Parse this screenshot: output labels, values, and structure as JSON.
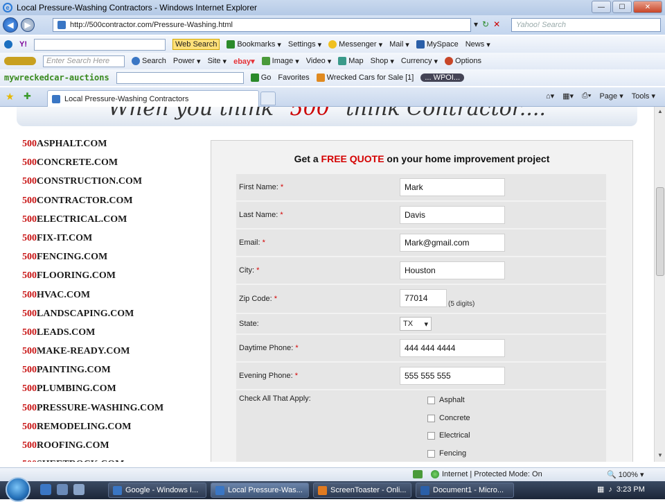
{
  "window": {
    "title": "Local Pressure-Washing Contractors - Windows Internet Explorer"
  },
  "address": {
    "url": "http://500contractor.com/Pressure-Washing.html",
    "search_placeholder": "Yahoo! Search"
  },
  "toolbar1": {
    "web_search": "Web Search",
    "bookmarks": "Bookmarks",
    "settings": "Settings",
    "messenger": "Messenger",
    "mail": "Mail",
    "myspace": "MySpace",
    "news": "News"
  },
  "toolbar2": {
    "search_placeholder": "Enter Search Here",
    "search": "Search",
    "power": "Power",
    "site": "Site",
    "image": "Image",
    "video": "Video",
    "map": "Map",
    "shop": "Shop",
    "currency": "Currency",
    "options": "Options"
  },
  "toolbar3": {
    "brand": "mywreckedcar-auctions",
    "go": "Go",
    "favorites": "Favorites",
    "wrecked": "Wrecked Cars for Sale",
    "wrecked_count": "[1]",
    "wpoi": "... WPOI..."
  },
  "tab": {
    "label": "Local Pressure-Washing Contractors"
  },
  "command": {
    "page": "Page",
    "tools": "Tools"
  },
  "banner": {
    "pre": "When you think ",
    "num": "\"500\"",
    "post": " think Contractor...."
  },
  "sites": [
    {
      "num": "500",
      "dom": "ASPHALT.COM"
    },
    {
      "num": "500",
      "dom": "CONCRETE.COM"
    },
    {
      "num": "500",
      "dom": "CONSTRUCTION.COM"
    },
    {
      "num": "500",
      "dom": "CONTRACTOR.COM"
    },
    {
      "num": "500",
      "dom": "ELECTRICAL.COM"
    },
    {
      "num": "500",
      "dom": "FIX-IT.COM"
    },
    {
      "num": "500",
      "dom": "FENCING.COM"
    },
    {
      "num": "500",
      "dom": "FLOORING.COM"
    },
    {
      "num": "500",
      "dom": "HVAC.COM"
    },
    {
      "num": "500",
      "dom": "LANDSCAPING.COM"
    },
    {
      "num": "500",
      "dom": "LEADS.COM"
    },
    {
      "num": "500",
      "dom": "MAKE-READY.COM"
    },
    {
      "num": "500",
      "dom": "PAINTING.COM"
    },
    {
      "num": "500",
      "dom": "PLUMBING.COM"
    },
    {
      "num": "500",
      "dom": "PRESSURE-WASHING.COM"
    },
    {
      "num": "500",
      "dom": "REMODELING.COM"
    },
    {
      "num": "500",
      "dom": "ROOFING.COM"
    },
    {
      "num": "500",
      "dom": "SHEETROCK.COM"
    }
  ],
  "form": {
    "title_pre": "Get a ",
    "title_free": "FREE QUOTE",
    "title_post": " on your home improvement project",
    "first_name_label": "First Name:",
    "first_name": "Mark",
    "last_name_label": "Last Name:",
    "last_name": "Davis",
    "email_label": "Email:",
    "email": "Mark@gmail.com",
    "city_label": "City:",
    "city": "Houston",
    "zip_label": "Zip Code:",
    "zip": "77014",
    "zip_hint": "(5 digits)",
    "state_label": "State:",
    "state": "TX",
    "day_phone_label": "Daytime Phone:",
    "day_phone": "444 444 4444",
    "eve_phone_label": "Evening Phone:",
    "eve_phone": "555 555 555",
    "check_label": "Check All That Apply:",
    "req": "*",
    "checks": [
      "Asphalt",
      "Concrete",
      "Electrical",
      "Fencing"
    ]
  },
  "status": {
    "zone": "Internet | Protected Mode: On",
    "zoom": "100%"
  },
  "taskbar": {
    "items": [
      "Google - Windows I...",
      "Local Pressure-Was...",
      "ScreenToaster - Onli...",
      "Document1 - Micro..."
    ],
    "time": "3:23 PM"
  }
}
